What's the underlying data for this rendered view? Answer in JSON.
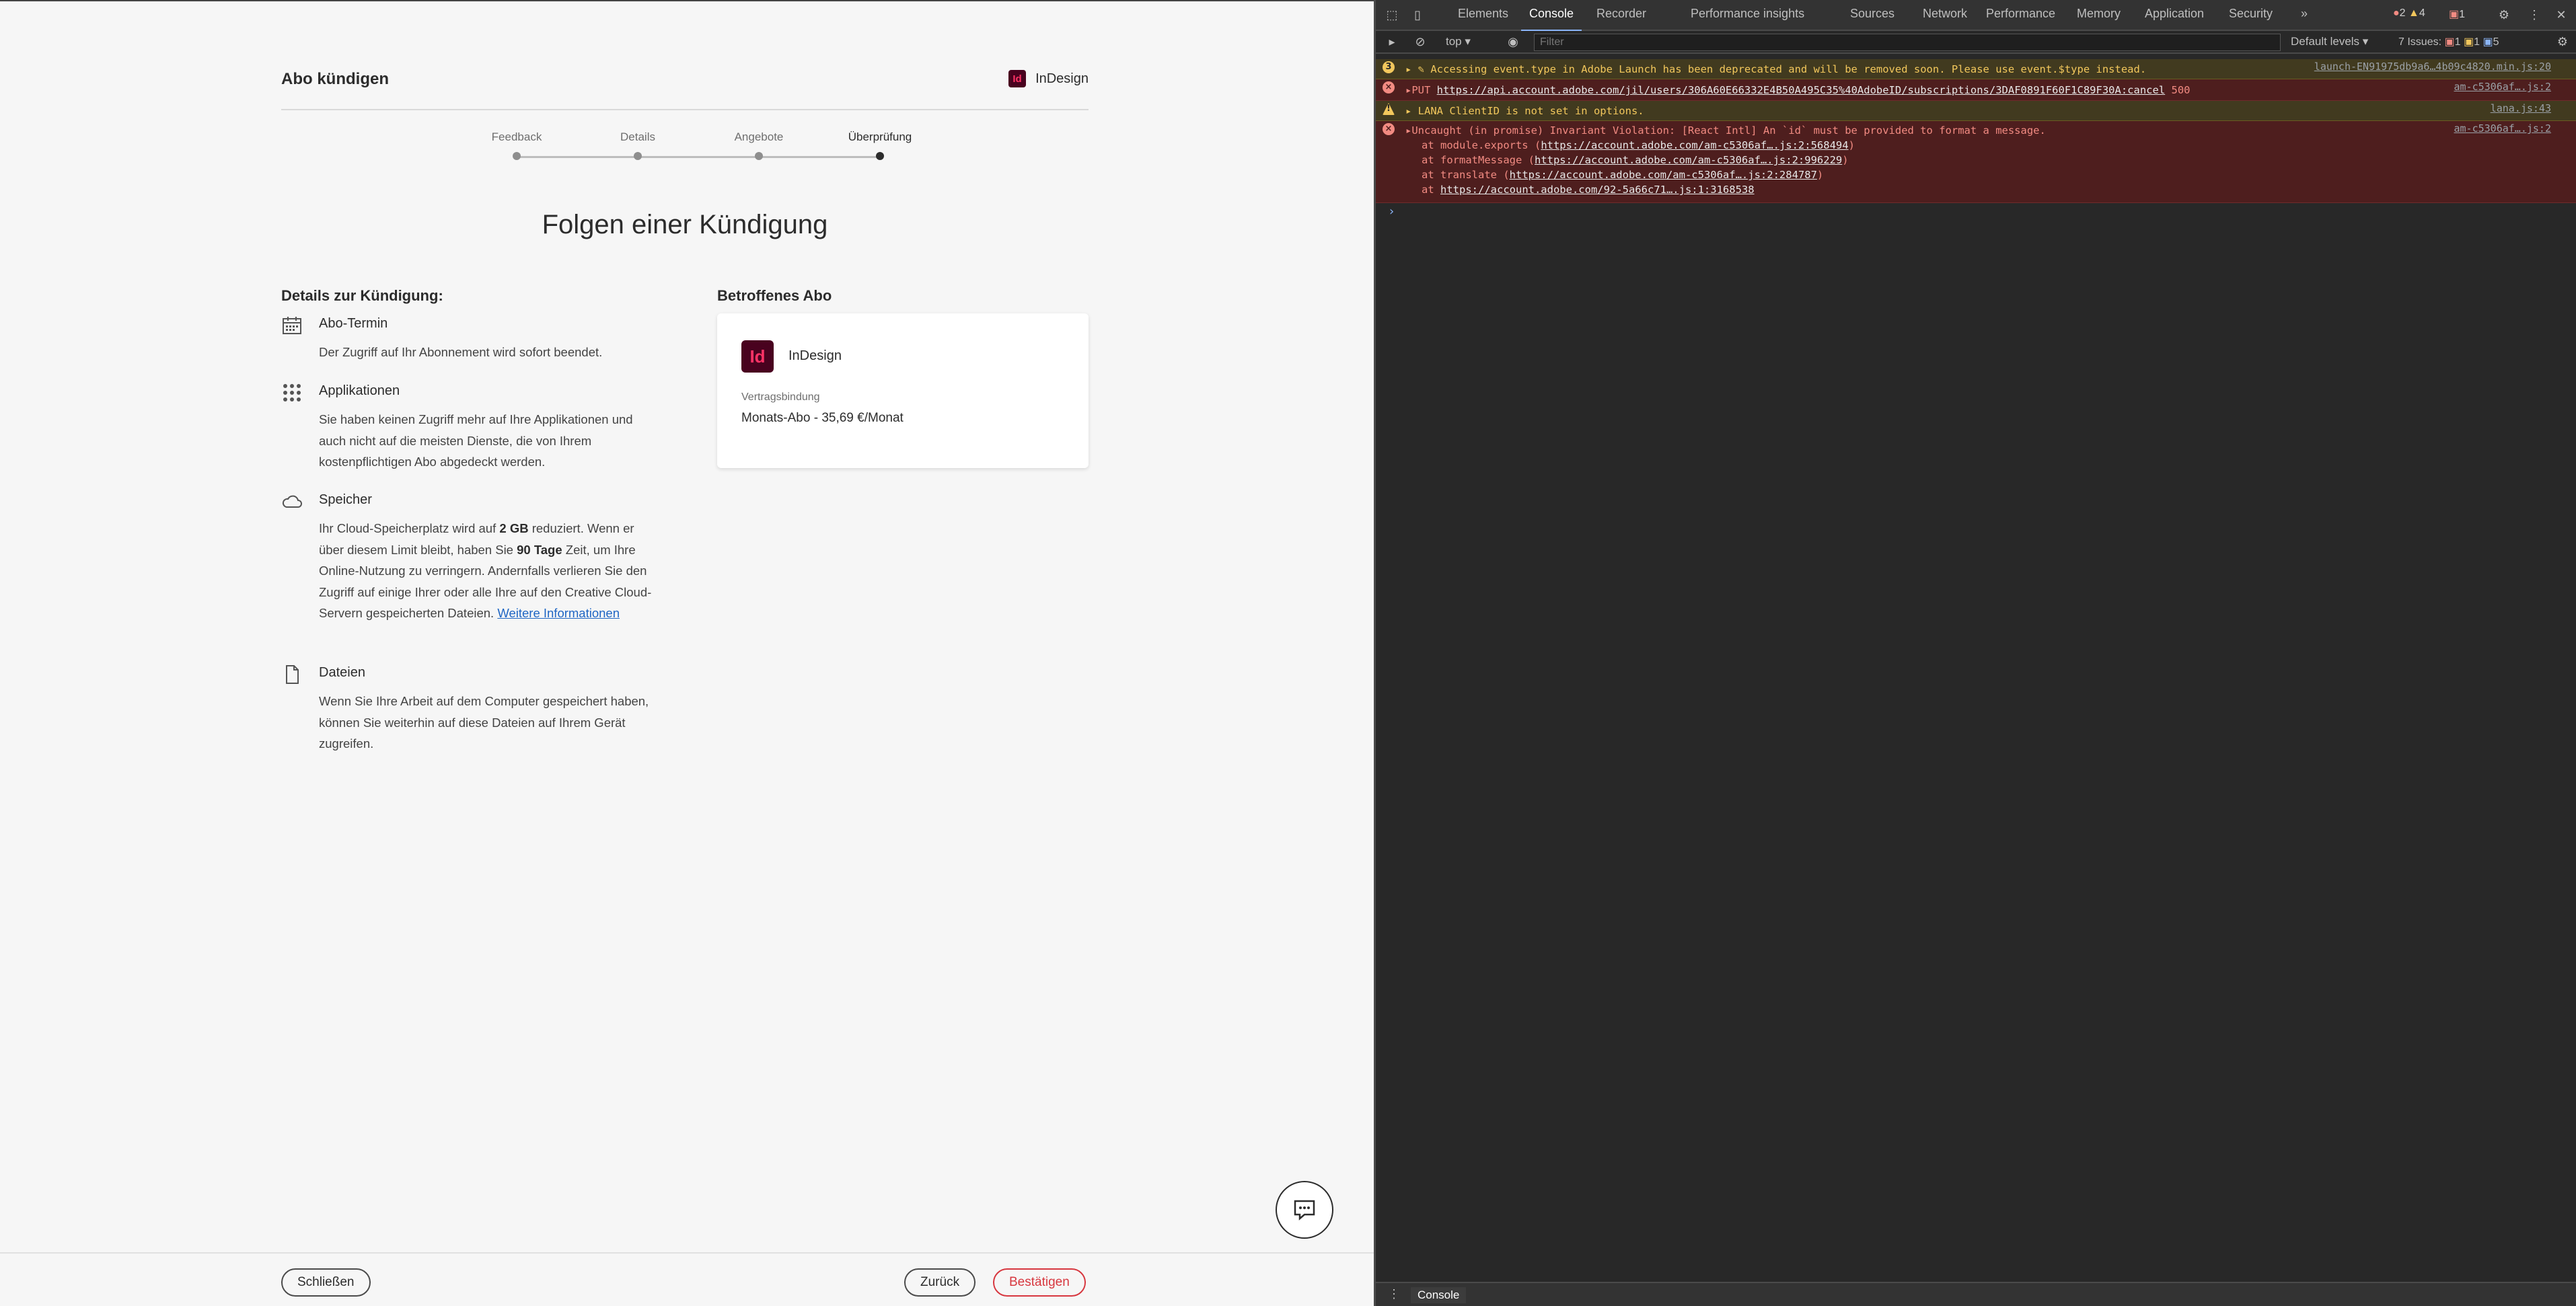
{
  "header": {
    "title": "Abo kündigen",
    "app_name": "InDesign",
    "app_badge": "Id"
  },
  "stepper": {
    "steps": [
      "Feedback",
      "Details",
      "Angebote",
      "Überprüfung"
    ],
    "active": 3
  },
  "heading": "Folgen einer Kündigung",
  "details": {
    "title": "Details zur Kündigung:",
    "items": [
      {
        "icon": "calendar-icon",
        "title": "Abo-Termin",
        "text": "Der Zugriff auf Ihr Abonnement wird sofort beendet."
      },
      {
        "icon": "apps-grid-icon",
        "title": "Applikationen",
        "text": "Sie haben keinen Zugriff mehr auf Ihre Applikationen und auch nicht auf die meisten Dienste, die von Ihrem kostenpflichtigen Abo abgedeckt werden."
      },
      {
        "icon": "cloud-icon",
        "title": "Speicher",
        "text_pre": "Ihr Cloud-Speicherplatz wird auf ",
        "bold1": "2 GB",
        "text_mid1": " reduziert. Wenn er über diesem Limit bleibt, haben Sie ",
        "bold2": "90 Tage",
        "text_mid2": " Zeit, um Ihre Online-Nutzung zu verringern. Andernfalls verlieren Sie den Zugriff auf einige Ihrer oder alle Ihre auf den Creative Cloud-Servern gespeicherten Dateien. ",
        "link": "Weitere Informationen"
      },
      {
        "icon": "file-icon",
        "title": "Dateien",
        "text": "Wenn Sie Ihre Arbeit auf dem Computer gespeichert haben, können Sie weiterhin auf diese Dateien auf Ihrem Gerät zugreifen."
      }
    ]
  },
  "subscription": {
    "title": "Betroffenes Abo",
    "badge": "Id",
    "name": "InDesign",
    "label": "Vertragsbindung",
    "price": "Monats-Abo - 35,69 €/Monat"
  },
  "footer": {
    "close": "Schließen",
    "back": "Zurück",
    "confirm": "Bestätigen"
  },
  "devtools": {
    "tabs": [
      "Elements",
      "Console",
      "Recorder",
      "Performance insights",
      "Sources",
      "Network",
      "Performance",
      "Memory",
      "Application",
      "Security",
      "»"
    ],
    "active_tab": "Console",
    "counts": {
      "errors": "2",
      "warnings": "4",
      "issues_badge": "1"
    },
    "toolbar": {
      "context": "top",
      "filter_placeholder": "Filter",
      "levels": "Default levels",
      "issues_label": "7 Issues:",
      "issue_err": "1",
      "issue_warn": "1",
      "issue_info": "5"
    },
    "logs": [
      {
        "level": "warn",
        "count": "3",
        "text": "▸ ✎ Accessing event.type in Adobe Launch has been deprecated and will be removed soon. Please use event.$type instead.",
        "source": "launch-EN91975db9a6…4b09c4820.min.js:20"
      },
      {
        "level": "error",
        "prefix": "▸PUT ",
        "url": "https://api.account.adobe.com/jil/users/306A60E66332E4B50A495C35%40AdobeID/subscriptions/3DAF0891F60F1C89F30A:cancel",
        "suffix": " 500",
        "source": "am-c5306af….js:2"
      },
      {
        "level": "warn",
        "text": "▸ LANA ClientID is not set in options.",
        "source": "lana.js:43"
      },
      {
        "level": "error",
        "text": "▸Uncaught (in promise) Invariant Violation: [React Intl] An `id` must be provided to format a message.",
        "source": "am-c5306af….js:2"
      }
    ],
    "stack": [
      {
        "pre": "at module.exports (",
        "url": "https://account.adobe.com/am-c5306af….js:2:568494",
        "post": ")"
      },
      {
        "pre": "at formatMessage (",
        "url": "https://account.adobe.com/am-c5306af….js:2:996229",
        "post": ")"
      },
      {
        "pre": "at translate (",
        "url": "https://account.adobe.com/am-c5306af….js:2:284787",
        "post": ")"
      },
      {
        "pre": "at ",
        "url": "https://account.adobe.com/92-5a66c71….js:1:3168538",
        "post": ""
      }
    ],
    "drawer_tab": "Console"
  }
}
